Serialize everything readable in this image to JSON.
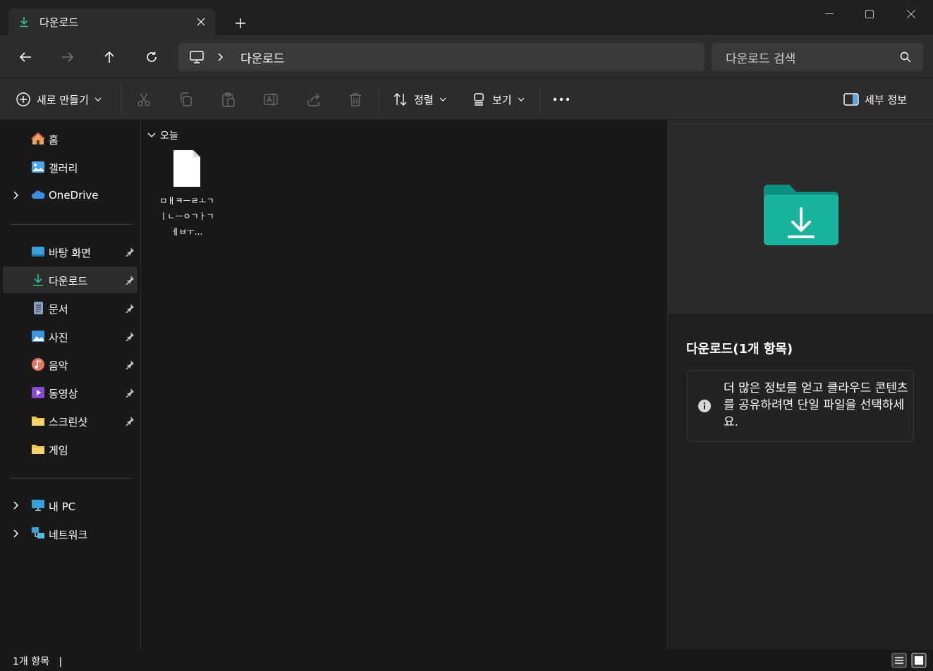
{
  "window": {
    "tab_title": "다운로드",
    "icons": {
      "tab": "download-icon",
      "close": "close-icon",
      "new_tab": "plus-icon",
      "minimize": "minimize-icon",
      "maximize": "maximize-icon",
      "close_window": "close-window-icon"
    }
  },
  "address": {
    "breadcrumb": [
      "다운로드"
    ],
    "search_placeholder": "다운로드 검색",
    "icons": {
      "back": "back-arrow-icon",
      "forward": "forward-arrow-icon",
      "up": "up-arrow-icon",
      "refresh": "refresh-icon",
      "pc": "pc-icon",
      "separator": "chevron-right-icon",
      "search": "search-icon"
    }
  },
  "toolbar": {
    "new_label": "새로 만들기",
    "sort_label": "정렬",
    "view_label": "보기",
    "details_label": "세부 정보",
    "icons": [
      "plus-circle-icon",
      "cut-icon",
      "copy-icon",
      "paste-icon",
      "rename-icon",
      "share-icon",
      "delete-icon",
      "sort-icon",
      "view-icon",
      "more-icon",
      "details-pane-icon"
    ]
  },
  "sidebar": {
    "items": [
      {
        "label": "홈",
        "icon": "home-icon"
      },
      {
        "label": "갤러리",
        "icon": "gallery-icon"
      },
      {
        "label": "OneDrive",
        "icon": "cloud-icon",
        "expandable": true
      },
      {
        "label": "바탕 화면",
        "icon": "desktop-icon",
        "pinned": true
      },
      {
        "label": "다운로드",
        "icon": "download-icon",
        "pinned": true,
        "selected": true
      },
      {
        "label": "문서",
        "icon": "document-icon",
        "pinned": true
      },
      {
        "label": "사진",
        "icon": "pictures-icon",
        "pinned": true
      },
      {
        "label": "음악",
        "icon": "music-icon",
        "pinned": true
      },
      {
        "label": "동영상",
        "icon": "video-icon",
        "pinned": true
      },
      {
        "label": "스크린샷",
        "icon": "folder-icon",
        "pinned": true
      },
      {
        "label": "게임",
        "icon": "folder-icon"
      },
      {
        "label": "내 PC",
        "icon": "pc-icon",
        "expandable": true
      },
      {
        "label": "네트워크",
        "icon": "network-icon",
        "expandable": true
      }
    ]
  },
  "content": {
    "group_label": "오늘",
    "files": [
      {
        "name": "ㅁㅐㅋㅡㄹㅗㄱㅣㄴㅡㅇㄱㅏㄱㅔㅂㅜ...",
        "icon": "file-icon"
      }
    ]
  },
  "details": {
    "title": "다운로드(1개 항목)",
    "info_text": "더 많은 정보를 얻고 클라우드 콘텐츠를 공유하려면 단일 파일을 선택하세요.",
    "icons": {
      "preview": "download-folder-icon",
      "info": "info-icon"
    }
  },
  "status": {
    "item_count": "1개 항목",
    "separator": "|",
    "icons": [
      "details-view-icon",
      "tiles-view-icon"
    ]
  },
  "colors": {
    "accent": "#1ab394",
    "folder": "#f0c04a",
    "background": "#191919",
    "panel": "#2c2c2c"
  }
}
